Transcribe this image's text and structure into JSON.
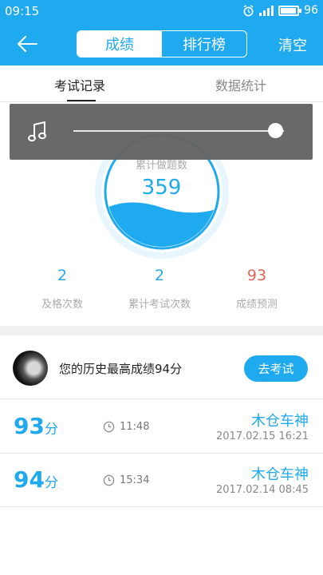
{
  "status_bar": {
    "time": "09:15",
    "battery": "96",
    "battery_level": 0.96
  },
  "navbar": {
    "segment_active": "成绩",
    "segment_inactive": "排行榜",
    "clear": "清空"
  },
  "tabs": {
    "exam_records": "考试记录",
    "statistics": "数据统计"
  },
  "gauge": {
    "label": "累计做题数",
    "value": "359"
  },
  "player": {
    "progress": 0.96
  },
  "stats": [
    {
      "value": "2",
      "label": "及格次数"
    },
    {
      "value": "2",
      "label": "累计考试次数"
    },
    {
      "value": "93",
      "label": "成绩预测"
    }
  ],
  "best": {
    "text": "您的历史最高成绩94分",
    "button": "去考试"
  },
  "records": [
    {
      "score": "93",
      "unit": "分",
      "duration": "11:48",
      "name": "木仓车神",
      "date": "2017.02.15  16:21"
    },
    {
      "score": "94",
      "unit": "分",
      "duration": "15:34",
      "name": "木仓车神",
      "date": "2017.02.14  08:45"
    }
  ],
  "colors": {
    "accent": "#1fa9ee",
    "prediction": "#e1685a",
    "player_bg": "#646464"
  }
}
